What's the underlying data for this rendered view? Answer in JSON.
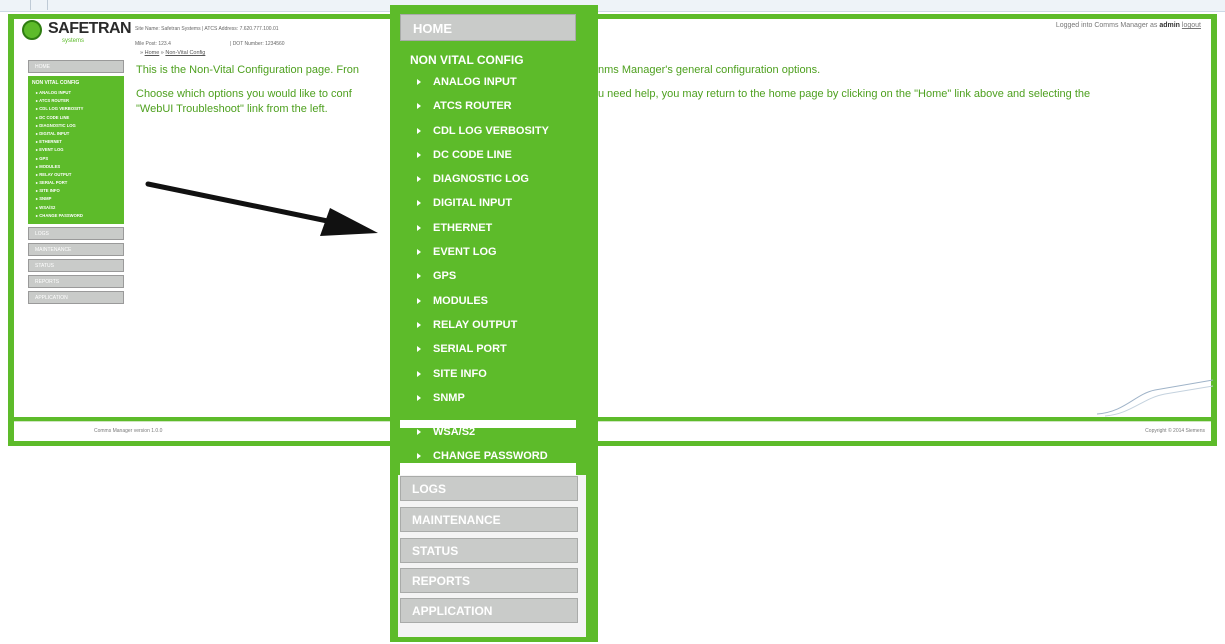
{
  "header": {
    "logo_word": "SAFETRAN",
    "logo_sub": "systems",
    "site_name_line": "Site Name: Safetran Systems | ATCS Address: 7.620.777.100.01",
    "mile_post": "Mile Post:   123.4",
    "dot_number": "| DOT Number:  1234560",
    "logged_in_prefix": "Logged into Comms Manager as",
    "logged_in_user": "admin",
    "logout_label": "logout"
  },
  "breadcrumb": {
    "sep": "»",
    "home": "Home",
    "current": "Non-Vital Config"
  },
  "main": {
    "para1": "This is the Non-Vital Configuration page. Fron",
    "para1_end": "nms Manager's general configuration options.",
    "para2_start": "Choose which options you would like to conf",
    "para2_end": "u need help, you may return to the home page by clicking on the \"Home\" link above and selecting the",
    "para2_line2": "\"WebUI Troubleshoot\" link from the left."
  },
  "footer": {
    "version": "Comms Manager version 1.0.0",
    "copyright": "Copyright © 2014 Siemens"
  },
  "small_sidebar": {
    "home": "HOME",
    "section": "NON VITAL CONFIG",
    "items": [
      "ANALOG INPUT",
      "ATCS ROUTER",
      "CDL LOG VERBOSITY",
      "DC CODE LINE",
      "DIAGNOSTIC LOG",
      "DIGITAL INPUT",
      "ETHERNET",
      "EVENT LOG",
      "GPS",
      "MODULES",
      "RELAY OUTPUT",
      "SERIAL PORT",
      "SITE INFO",
      "SNMP",
      "WSA/S2",
      "CHANGE PASSWORD"
    ],
    "groups": [
      "LOGS",
      "MAINTENANCE",
      "STATUS",
      "REPORTS",
      "APPLICATION"
    ]
  },
  "zoom_menu": {
    "home": "HOME",
    "section": "NON VITAL CONFIG",
    "items": [
      "ANALOG INPUT",
      "ATCS ROUTER",
      "CDL LOG VERBOSITY",
      "DC CODE LINE",
      "DIAGNOSTIC LOG",
      "DIGITAL INPUT",
      "ETHERNET",
      "EVENT LOG",
      "GPS",
      "MODULES",
      "RELAY OUTPUT",
      "SERIAL PORT",
      "SITE INFO",
      "SNMP"
    ],
    "items2": [
      "WSA/S2",
      "CHANGE PASSWORD"
    ],
    "groups": [
      "LOGS",
      "MAINTENANCE",
      "STATUS",
      "REPORTS",
      "APPLICATION"
    ]
  },
  "colors": {
    "brand_green": "#5dbb2a",
    "text_green": "#4ea01f",
    "menu_gray": "#c9cbc9"
  }
}
